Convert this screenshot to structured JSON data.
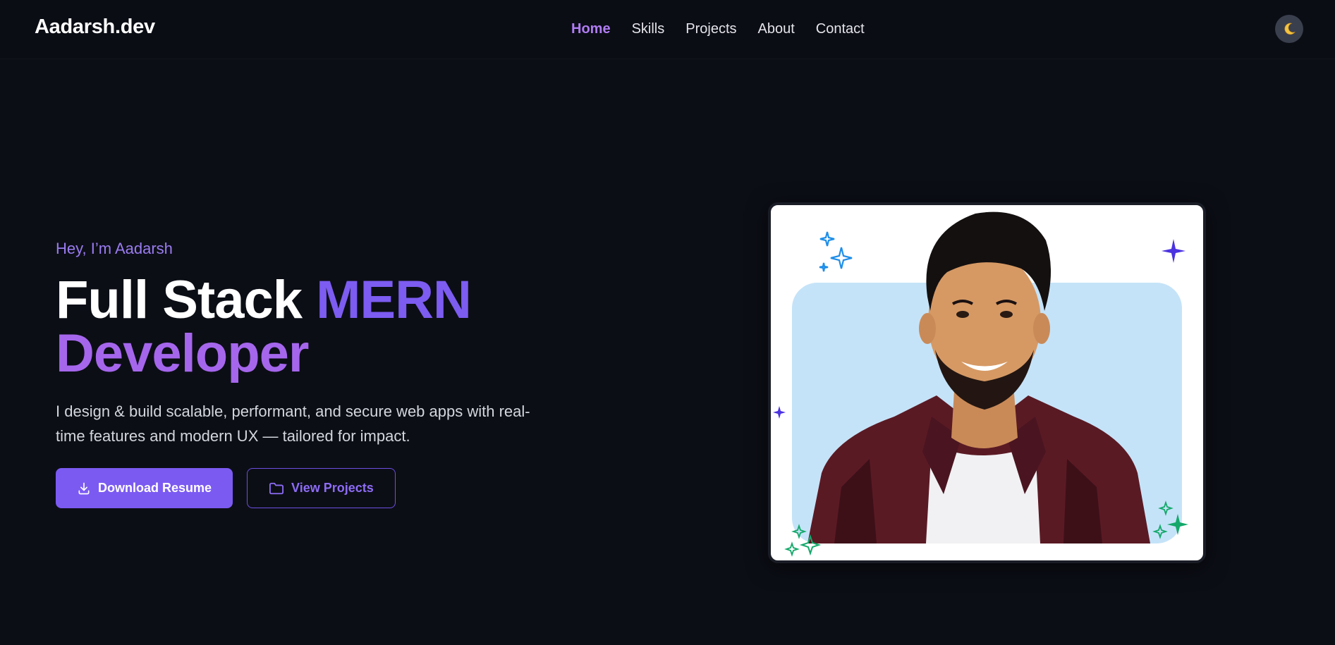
{
  "navbar": {
    "brand": "Aadarsh.dev",
    "links": [
      {
        "label": "Home",
        "active": true
      },
      {
        "label": "Skills",
        "active": false
      },
      {
        "label": "Projects",
        "active": false
      },
      {
        "label": "About",
        "active": false
      },
      {
        "label": "Contact",
        "active": false
      }
    ],
    "theme_toggle_icon": "moon-icon"
  },
  "hero": {
    "greeting": "Hey, I’m Aadarsh",
    "headline_part1": "Full Stack ",
    "headline_part2": "MERN",
    "headline_part3": "Developer",
    "description": "I design & build scalable, performant, and secure web apps with real-time features and modern UX — tailored for impact.",
    "primary_button": {
      "label": "Download Resume",
      "icon": "download-icon"
    },
    "secondary_button": {
      "label": "View Projects",
      "icon": "folder-icon"
    }
  },
  "colors": {
    "background": "#0c0e16",
    "accent": "#7b5af2",
    "accent_light": "#a566ec",
    "photo_backdrop": "#c5e3f8"
  }
}
